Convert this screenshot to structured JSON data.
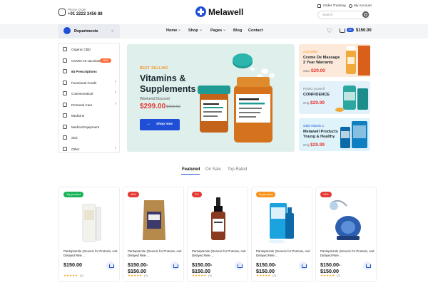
{
  "header": {
    "phone_label": "Phone Order",
    "phone_number": "+01 2222 3456 88",
    "logo_text": "Melawell",
    "order_tracking": "Order Tracking",
    "my_account": "My Account",
    "search_placeholder": "Search"
  },
  "nav": {
    "departments": "Departments",
    "items": [
      "Home",
      "Shop",
      "Pages",
      "Blog",
      "Contact"
    ],
    "cart_badge": "0/0",
    "cart_total": "$150.00"
  },
  "sidebar": {
    "items": [
      {
        "label": "Organic CBD"
      },
      {
        "label": "COVID-19 vaccines",
        "badge": "NEW"
      },
      {
        "label": "84 Prescriptions"
      },
      {
        "label": "Functional Foods"
      },
      {
        "label": "Cosmeceutical"
      },
      {
        "label": "Personal Care"
      },
      {
        "label": "Medicine"
      },
      {
        "label": "Medical Equipment"
      },
      {
        "label": "Sick"
      },
      {
        "label": "Other"
      }
    ]
  },
  "hero": {
    "eyebrow": "BEST SELLING",
    "title_line1": "Vitamins &",
    "title_line2": "Supplements",
    "subtitle": "Weekend Discount",
    "price": "$299.00",
    "old_price": "$399.00",
    "button": "Shop now"
  },
  "promos": [
    {
      "eyebrow": "Acts within",
      "title_line1": "Creme De Massage",
      "title_line2": "2 Year Warranty",
      "price_prefix": "Save",
      "price": "$29.00",
      "bg": "#fde9d9"
    },
    {
      "eyebrow": "Protect yourself",
      "title_line1": "CONFIDENCE",
      "title_line2": "",
      "price_prefix": "Only",
      "price": "$29.99",
      "bg": "#e3f1fb"
    },
    {
      "eyebrow": "Solid Vitamin C",
      "title_line1": "Melawell Products",
      "title_line2": "Young & Healthy",
      "price_prefix": "Only",
      "price": "$29.99",
      "bg": "#dff3fb"
    }
  ],
  "tabs": [
    "Featured",
    "On Sale",
    "Top Rated"
  ],
  "products": [
    {
      "badge": "Top product",
      "badge_color": "#1bb35a",
      "name": "Pantoprazole (Generic for Protonix, Axit Delayed Rele ...",
      "price": "$150.00",
      "stars": "★★★★★",
      "rating": "(2)"
    },
    {
      "badge": "18%",
      "badge_color": "#e53935",
      "name": "Pantoprazole (Generic for Protonix, Axit Delayed Rele ...",
      "price": "$150.00-\n$150.00",
      "stars": "★★★★★",
      "rating": "(2)"
    },
    {
      "badge": "2%",
      "badge_color": "#e53935",
      "name": "Pantoprazole (Generic for Protonix, Axit Delayed Rele ...",
      "price": "$150.00-\n$150.00",
      "stars": "★★★★★",
      "rating": "(2)"
    },
    {
      "badge": "Super price",
      "badge_color": "#f7941d",
      "name": "Pantoprazole (Generic for Protonix, Axit Delayed Rele ...",
      "price": "$150.00-\n$150.00",
      "stars": "★★★★★",
      "rating": "(2)"
    },
    {
      "badge": "14%",
      "badge_color": "#e53935",
      "name": "Pantoprazole (Generic for Protonix, Axit Delayed Rele ...",
      "price": "$150.00-\n$150.00",
      "stars": "★★★★★",
      "rating": "(2)"
    }
  ],
  "colors": {
    "brand": "#1f4fd6",
    "accent": "#f7941d",
    "sale": "#e53935"
  }
}
